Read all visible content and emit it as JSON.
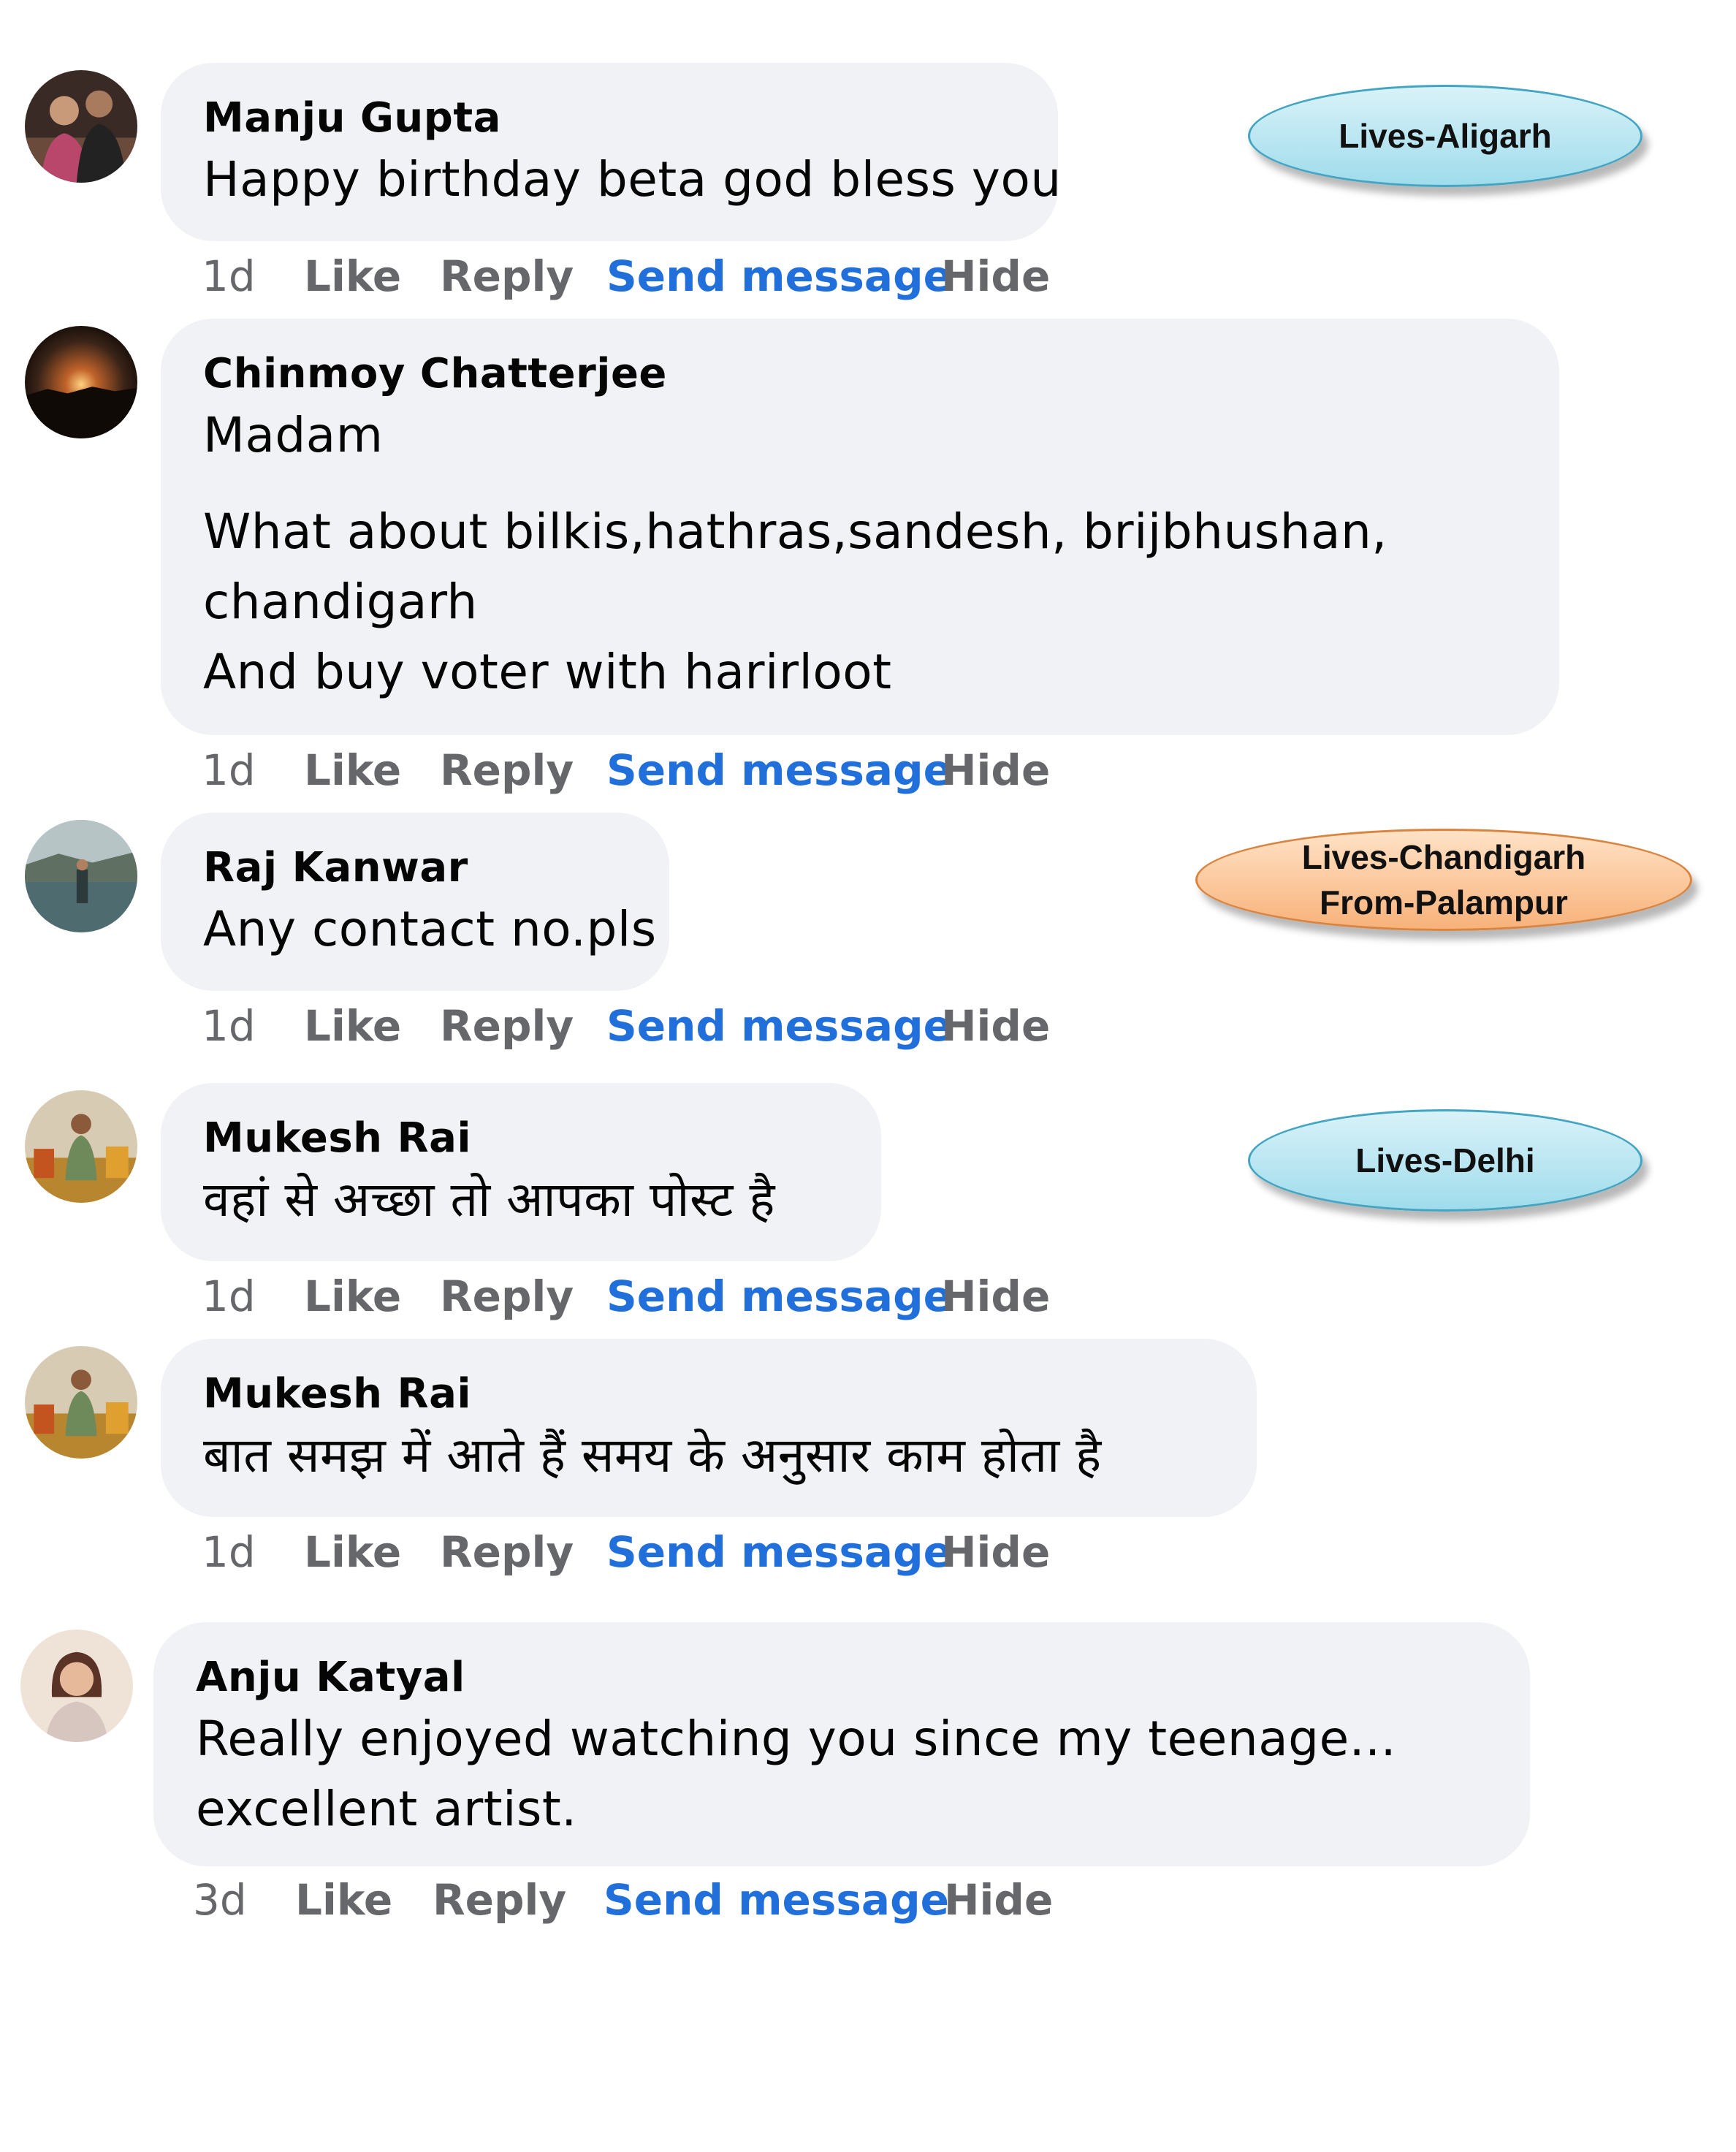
{
  "actions": {
    "like": "Like",
    "reply": "Reply",
    "send_message": "Send message",
    "hide": "Hide"
  },
  "colors": {
    "bubble_bg": "#f0f2f5",
    "action_gray": "#65676b",
    "send_message_blue": "#216fdb",
    "note_blue": "#9fdcec",
    "note_orange": "#f8b27a"
  },
  "comments": [
    {
      "author": "Manju Gupta",
      "lines": [
        "Happy birthday beta god bless you"
      ],
      "time": "1d",
      "avatar_icon": "user-photo-avatar-icon"
    },
    {
      "author": "Chinmoy Chatterjee",
      "lines": [
        "Madam",
        "What about bilkis,hathras,sandesh, brijbhushan,",
        "chandigarh",
        "And buy voter with harirloot"
      ],
      "time": "1d",
      "avatar_icon": "sunset-photo-avatar-icon"
    },
    {
      "author": "Raj Kanwar",
      "lines": [
        "Any contact no.pls"
      ],
      "time": "1d",
      "avatar_icon": "outdoor-photo-avatar-icon"
    },
    {
      "author": "Mukesh Rai",
      "lines": [
        "वहां से अच्छा तो आपका पोस्ट है"
      ],
      "time": "1d",
      "avatar_icon": "user-photo-avatar-icon"
    },
    {
      "author": "Mukesh Rai",
      "lines": [
        "बात समझ में आते हैं समय के अनुसार काम होता है"
      ],
      "time": "1d",
      "avatar_icon": "user-photo-avatar-icon"
    },
    {
      "author": "Anju Katyal",
      "lines": [
        "Really enjoyed watching you since my teenage...",
        "excellent artist."
      ],
      "time": "3d",
      "avatar_icon": "user-photo-avatar-icon"
    }
  ],
  "annotations": [
    {
      "lines": [
        "Lives-Aligarh"
      ],
      "color": "blue"
    },
    {
      "lines": [
        "Lives-Chandigarh",
        "From-Palampur"
      ],
      "color": "orange"
    },
    {
      "lines": [
        "Lives-Delhi"
      ],
      "color": "blue"
    }
  ]
}
